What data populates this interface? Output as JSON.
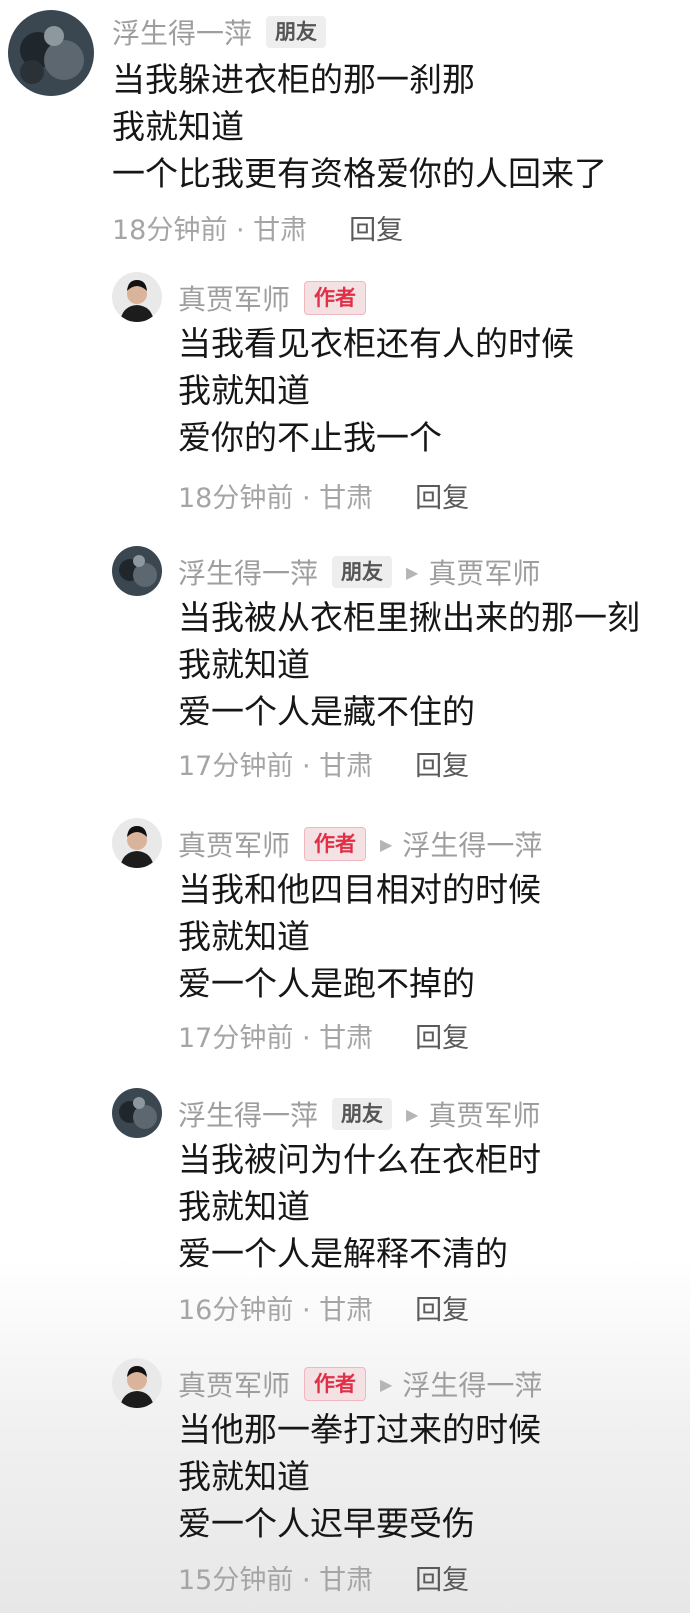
{
  "comments": [
    {
      "user": "浮生得一萍",
      "badge": "朋友",
      "badge_type": "friend",
      "reply_to": "",
      "lines": [
        "当我躲进衣柜的那一刹那",
        "我就知道",
        "一个比我更有资格爱你的人回来了"
      ],
      "time": "18分钟前 · 甘肃",
      "reply_label": "回复",
      "avatar": "cat-avatar"
    },
    {
      "user": "真贾军师",
      "badge": "作者",
      "badge_type": "author",
      "reply_to": "",
      "lines": [
        "当我看见衣柜还有人的时候",
        "我就知道",
        "爱你的不止我一个"
      ],
      "time": "18分钟前 · 甘肃",
      "reply_label": "回复",
      "avatar": "man-avatar"
    },
    {
      "user": "浮生得一萍",
      "badge": "朋友",
      "badge_type": "friend",
      "reply_to": "真贾军师",
      "lines": [
        "当我被从衣柜里揪出来的那一刻",
        "我就知道",
        "爱一个人是藏不住的"
      ],
      "time": "17分钟前 · 甘肃",
      "reply_label": "回复",
      "avatar": "cat-avatar"
    },
    {
      "user": "真贾军师",
      "badge": "作者",
      "badge_type": "author",
      "reply_to": "浮生得一萍",
      "lines": [
        "当我和他四目相对的时候",
        "我就知道",
        "爱一个人是跑不掉的"
      ],
      "time": "17分钟前 · 甘肃",
      "reply_label": "回复",
      "avatar": "man-avatar"
    },
    {
      "user": "浮生得一萍",
      "badge": "朋友",
      "badge_type": "friend",
      "reply_to": "真贾军师",
      "lines": [
        "当我被问为什么在衣柜时",
        "我就知道",
        "爱一个人是解释不清的"
      ],
      "time": "16分钟前 · 甘肃",
      "reply_label": "回复",
      "avatar": "cat-avatar"
    },
    {
      "user": "真贾军师",
      "badge": "作者",
      "badge_type": "author",
      "reply_to": "浮生得一萍",
      "lines": [
        "当他那一拳打过来的时候",
        "我就知道",
        "爱一个人迟早要受伤"
      ],
      "time": "15分钟前 · 甘肃",
      "reply_label": "回复",
      "avatar": "man-avatar"
    }
  ],
  "colors": {
    "author_badge_text": "#e03048",
    "author_badge_bg": "#f4e1e3",
    "friend_badge_bg": "#eeeeee",
    "meta_text": "#a5a5a5"
  }
}
